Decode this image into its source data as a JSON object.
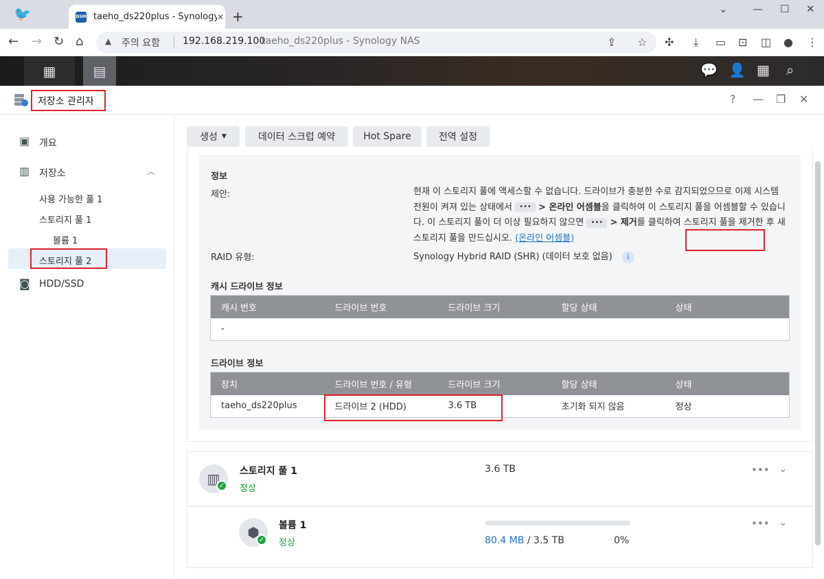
{
  "browser": {
    "tab_title": "taeho_ds220plus - Synology NAS",
    "favicon_text": "DSM",
    "new_tab": "+",
    "security_label": "주의 요함",
    "url_host": "192.168.219.100",
    "url_title": "taeho_ds220plus - Synology NAS"
  },
  "window": {
    "title": "저장소 관리자",
    "help": "?",
    "minimize": "—",
    "restore": "❐",
    "close": "✕"
  },
  "sidebar": {
    "overview": "개요",
    "storage": "저장소",
    "available_pool": "사용 가능한 풀 1",
    "pool1": "스토리지 풀 1",
    "volume1": "볼륨 1",
    "pool2": "스토리지 풀 2",
    "hdd_ssd": "HDD/SSD"
  },
  "toolbar": {
    "create": "생성",
    "scrub": "데이터 스크럽 예약",
    "hot_spare": "Hot Spare",
    "global_settings": "전역 설정"
  },
  "info": {
    "heading": "정보",
    "suggest_label": "제안:",
    "suggest_p1": "현재 이 스토리지 풀에 액세스할 수 없습니다. 드라이브가 충분한 수로 감지되었으므로 이제 시스템 전원이 켜져 있는 상태에서",
    "suggest_p2": "> 온라인 어셈블",
    "suggest_p3": "을 클릭하여 이 스토리지 풀을 어셈블할 수 있습니다. 이 스토리지 풀이 더 이상 필요하지 않으면",
    "suggest_p4": "> 제거",
    "suggest_p5": "를 클릭하여 스토리지 풀을 제거한 후 새 스토리지 풀을 만드십시오.",
    "suggest_link": "(온라인 어셈블)",
    "dots": "•••",
    "raid_label": "RAID 유형:",
    "raid_value": "Synology Hybrid RAID (SHR) (데이터 보호 없음)",
    "info_icon": "i"
  },
  "cache_table": {
    "title": "캐시 드라이브 정보",
    "headers": [
      "캐시 번호",
      "드라이브 번호",
      "드라이브 크기",
      "할당 상태",
      "상태"
    ],
    "empty": "-"
  },
  "drive_table": {
    "title": "드라이브 정보",
    "headers": [
      "장치",
      "드라이브 번호 / 유형",
      "드라이브 크기",
      "할당 상태",
      "상태"
    ],
    "rows": [
      [
        "taeho_ds220plus",
        "드라이브 2 (HDD)",
        "3.6 TB",
        "초기화 되지 않음",
        "정상"
      ]
    ]
  },
  "pool_row": {
    "title": "스토리지 풀 1",
    "status": "정상",
    "size": "3.6 TB",
    "more": "•••"
  },
  "volume_row": {
    "title": "볼륨 1",
    "status": "정상",
    "used": "80.4 MB",
    "sep": " / ",
    "total": "3.5 TB",
    "percent": "0%",
    "usage_fraction": 0.0,
    "more": "•••"
  },
  "colors": {
    "accent": "#1f73c9",
    "ok": "#1a9f37",
    "highlight": "#e0202a"
  }
}
